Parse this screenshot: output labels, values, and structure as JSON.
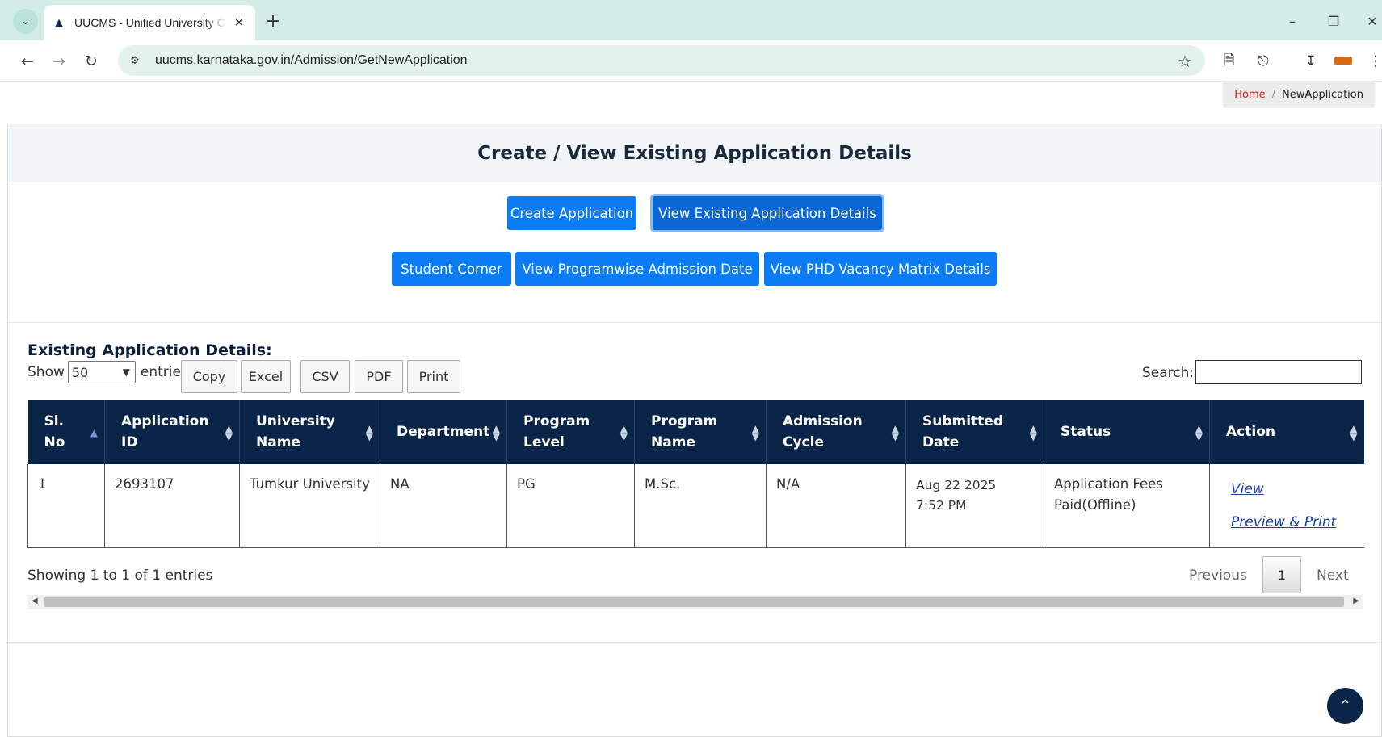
{
  "browser": {
    "tab_title": "UUCMS - Unified University College Management System",
    "url": "uucms.karnataka.gov.in/Admission/GetNewApplication"
  },
  "breadcrumb": {
    "home": "Home",
    "separator": "/",
    "current": "NewApplication"
  },
  "page_title": "Create / View Existing Application Details",
  "buttons": {
    "create_application": "Create Application",
    "view_existing": "View Existing Application Details",
    "student_corner": "Student Corner",
    "programwise_date": "View Programwise Admission Date",
    "phd_vacancy": "View PHD Vacancy Matrix Details"
  },
  "section_title": "Existing Application Details:",
  "table_controls": {
    "show_label": "Show",
    "entries_value": "50",
    "entries_label": "entries",
    "export": [
      "Copy",
      "Excel",
      "CSV",
      "PDF",
      "Print"
    ],
    "search_label": "Search:"
  },
  "table": {
    "headers": [
      [
        "Sl.",
        "No"
      ],
      [
        "Application",
        "ID"
      ],
      [
        "University",
        "Name"
      ],
      [
        "Department"
      ],
      [
        "Program",
        "Level"
      ],
      [
        "Program",
        "Name"
      ],
      [
        "Admission",
        "Cycle"
      ],
      [
        "Submitted",
        "Date"
      ],
      [
        "Status"
      ],
      [
        "Action"
      ]
    ],
    "rows": [
      {
        "sl_no": "1",
        "application_id": "2693107",
        "university": "Tumkur University",
        "department": "NA",
        "program_level": "PG",
        "program_name": "M.Sc.",
        "admission_cycle": "N/A",
        "submitted_date": "Aug 22 2025",
        "submitted_time": "7:52 PM",
        "status_line1": "Application Fees",
        "status_line2": "Paid(Offline)",
        "action_view": "View",
        "action_print": "Preview & Print"
      }
    ]
  },
  "footer": {
    "info": "Showing 1 to 1 of 1 entries",
    "previous": "Previous",
    "page": "1",
    "next": "Next"
  }
}
